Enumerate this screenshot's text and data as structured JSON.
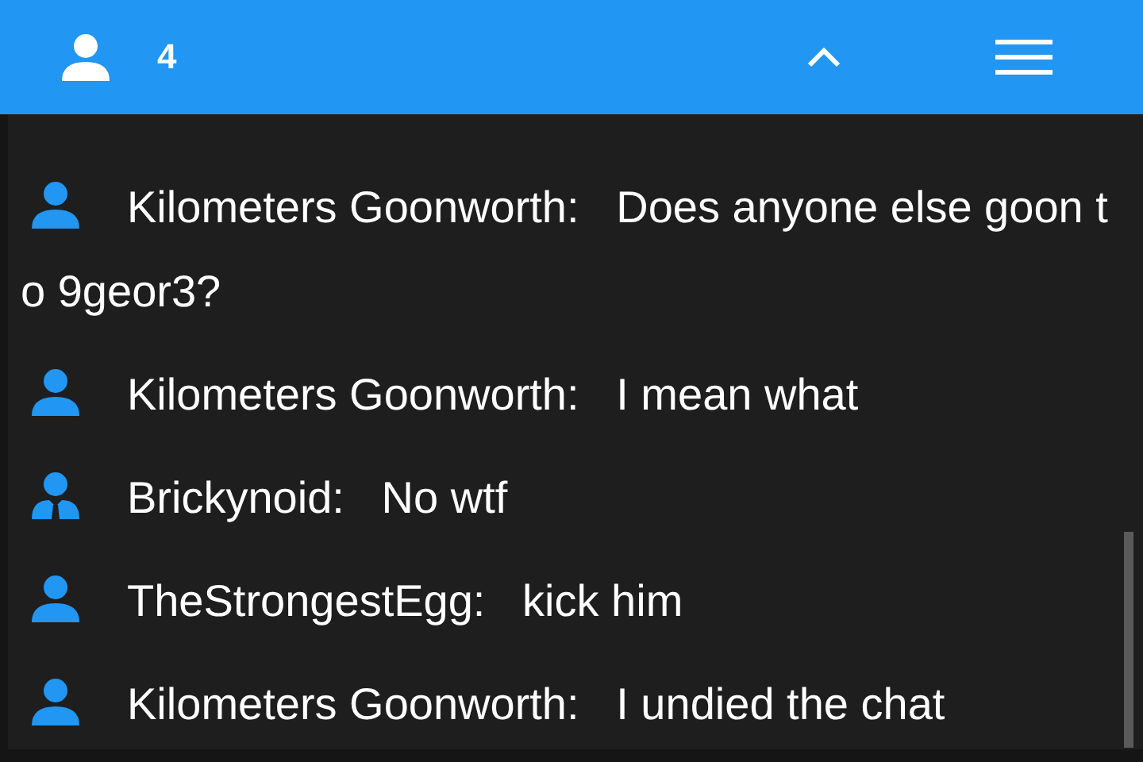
{
  "header": {
    "member_count": "4"
  },
  "messages": [
    {
      "kind": "user",
      "sender": "Kilometers Goonworth:",
      "text": "Does anyone else goon to 9geor3?"
    },
    {
      "kind": "user",
      "sender": "Kilometers Goonworth:",
      "text": "I mean what"
    },
    {
      "kind": "suit",
      "sender": "Brickynoid:",
      "text": "No wtf"
    },
    {
      "kind": "user",
      "sender": "TheStrongestEgg:",
      "text": "kick him"
    },
    {
      "kind": "user",
      "sender": "Kilometers Goonworth:",
      "text": "I undied the chat"
    }
  ]
}
